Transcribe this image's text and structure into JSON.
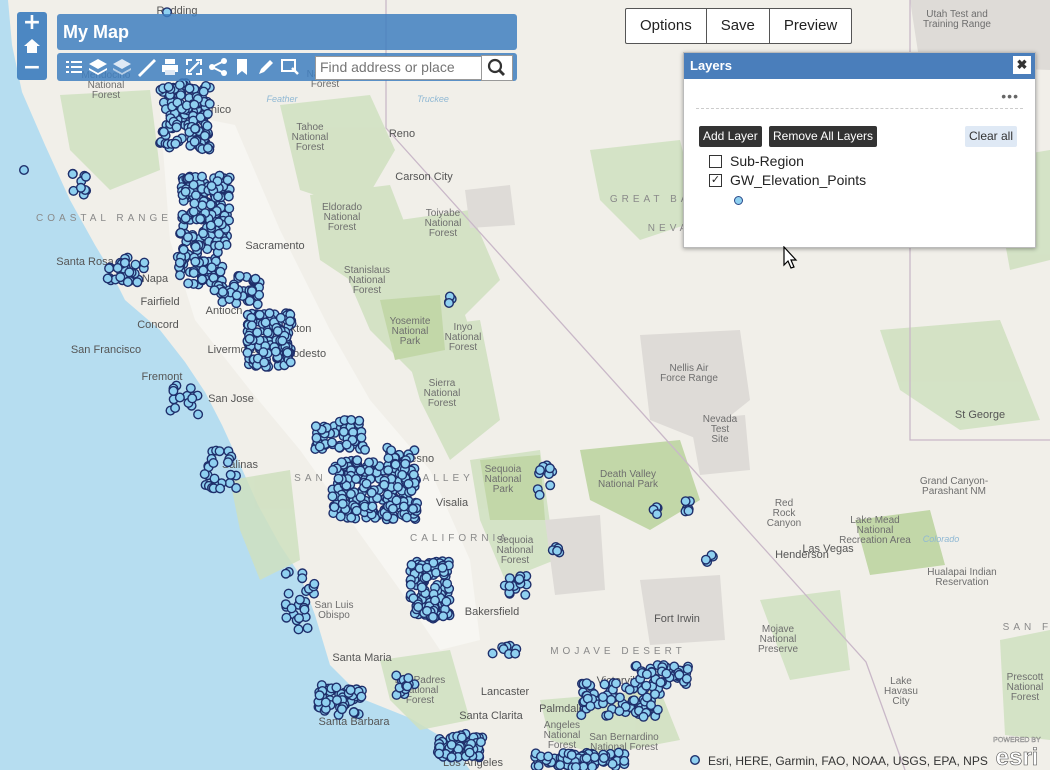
{
  "map": {
    "colors": {
      "ocean": "#b6ddf0",
      "land": "#f1efe9",
      "valley": "#f6f5f1",
      "forest": "#cfe0bf",
      "park": "#c2d7a8",
      "military": "#dedbd7",
      "border": "#c9c0c8",
      "point_fill": "#8fd0f0",
      "point_stroke": "#1f2f6b"
    },
    "labels": [
      {
        "text": "Redding"
      },
      {
        "text": "Chico"
      },
      {
        "text": "Mendocino\nNational\nForest"
      },
      {
        "text": "Tahoe\nNational\nForest"
      },
      {
        "text": "National\nForest"
      },
      {
        "text": "Reno"
      },
      {
        "text": "Carson City"
      },
      {
        "text": "COASTAL RANGE"
      },
      {
        "text": "Eldorado\nNational\nForest"
      },
      {
        "text": "Sacramento"
      },
      {
        "text": "Toiyabe\nNational\nForest"
      },
      {
        "text": "Santa Rosa"
      },
      {
        "text": "Napa"
      },
      {
        "text": "Fairfield"
      },
      {
        "text": "Stanislaus\nNational\nForest"
      },
      {
        "text": "Concord"
      },
      {
        "text": "Antioch"
      },
      {
        "text": "Stockton"
      },
      {
        "text": "Yosemite\nNational\nPark"
      },
      {
        "text": "Inyo\nNational\nForest"
      },
      {
        "text": "San Francisco"
      },
      {
        "text": "Livermore"
      },
      {
        "text": "Modesto"
      },
      {
        "text": "Fremont"
      },
      {
        "text": "San Jose"
      },
      {
        "text": "Sierra\nNational\nForest"
      },
      {
        "text": "Salinas"
      },
      {
        "text": "Fresno"
      },
      {
        "text": "SAN JOAQUIN VALLEY"
      },
      {
        "text": "Visalia"
      },
      {
        "text": "Sequoia\nNational\nPark"
      },
      {
        "text": "CALIFORNIA"
      },
      {
        "text": "Sequoia\nNational\nForest"
      },
      {
        "text": "Death Valley\nNational Park"
      },
      {
        "text": "Nellis Air\nForce Range"
      },
      {
        "text": "Nevada\nTest\nSite"
      },
      {
        "text": "Red\nRock\nCanyon"
      },
      {
        "text": "Las Vegas"
      },
      {
        "text": "Henderson"
      },
      {
        "text": "Lake Mead\nNational\nRecreation Area"
      },
      {
        "text": "Grand Canyon-\nParashant NM"
      },
      {
        "text": "Hualapai Indian\nReservation"
      },
      {
        "text": "St George"
      },
      {
        "text": "Utah Test and\nTraining Range"
      },
      {
        "text": "GREAT BASIN"
      },
      {
        "text": "NEVADA"
      },
      {
        "text": "Fort Irwin"
      },
      {
        "text": "Mojave\nNational\nPreserve"
      },
      {
        "text": "MOJAVE DESERT"
      },
      {
        "text": "San Luis\nObispo"
      },
      {
        "text": "Bakersfield"
      },
      {
        "text": "Santa Maria"
      },
      {
        "text": "Los Padres\nNational\nForest"
      },
      {
        "text": "Lancaster"
      },
      {
        "text": "Victorville"
      },
      {
        "text": "Santa Barbara"
      },
      {
        "text": "Santa Clarita"
      },
      {
        "text": "Angeles\nNational\nForest"
      },
      {
        "text": "San Bernardino\nNational Forest"
      },
      {
        "text": "Los Angeles"
      },
      {
        "text": "Lake\nHavasu\nCity"
      },
      {
        "text": "Prescott\nNational\nForest"
      },
      {
        "text": "SAN FR"
      },
      {
        "text": "Palmdale"
      },
      {
        "text": "Feather"
      },
      {
        "text": "Truckee"
      },
      {
        "text": "Colorado"
      }
    ]
  },
  "zoom": {
    "plus": "+",
    "home": "home-icon",
    "minus": "−"
  },
  "header": {
    "title": "My Map"
  },
  "toolbar": {
    "icons": [
      "list-icon",
      "layers-icon",
      "basemap-icon",
      "measure-icon",
      "print-icon",
      "fullscreen-icon",
      "share-icon",
      "bookmark-icon",
      "draw-icon",
      "select-icon"
    ]
  },
  "search": {
    "placeholder": "Find address or place"
  },
  "top_buttons": {
    "options": "Options",
    "save": "Save",
    "preview": "Preview"
  },
  "layers_panel": {
    "title": "Layers",
    "close": "✖",
    "more": "•••",
    "add_layer": "Add Layer",
    "remove_all": "Remove All Layers",
    "clear_all": "Clear all",
    "layers": [
      {
        "label": "Sub-Region",
        "checked": false
      },
      {
        "label": "GW_Elevation_Points",
        "checked": true
      }
    ]
  },
  "attribution": "Esri, HERE, Garmin, FAO, NOAA, USGS, EPA, NPS",
  "logo": {
    "line1": "POWERED BY",
    "line2": "esri"
  }
}
